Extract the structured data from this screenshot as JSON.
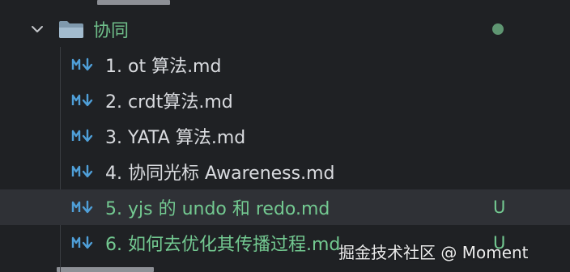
{
  "folder": {
    "name": "协同",
    "expanded": true,
    "status_dot_color": "#5f9672"
  },
  "files": [
    {
      "label": "1. ot 算法.md",
      "status": "",
      "icon": "markdown-icon"
    },
    {
      "label": "2. crdt算法.md",
      "status": "",
      "icon": "markdown-icon"
    },
    {
      "label": "3. YATA 算法.md",
      "status": "",
      "icon": "markdown-icon"
    },
    {
      "label": "4. 协同光标 Awareness.md",
      "status": "",
      "icon": "markdown-icon"
    },
    {
      "label": "5. yjs 的 undo 和 redo.md",
      "status": "U",
      "icon": "markdown-icon"
    },
    {
      "label": "6. 如何去优化其传播过程.md",
      "status": "U",
      "icon": "markdown-icon"
    }
  ],
  "watermark": "掘金技术社区 @ Moment",
  "colors": {
    "background": "#1f2124",
    "selected_row": "#2f3136",
    "untracked_green": "#73c991",
    "folder_icon": "#8fa9bf",
    "markdown_icon": "#4f9fd8"
  }
}
